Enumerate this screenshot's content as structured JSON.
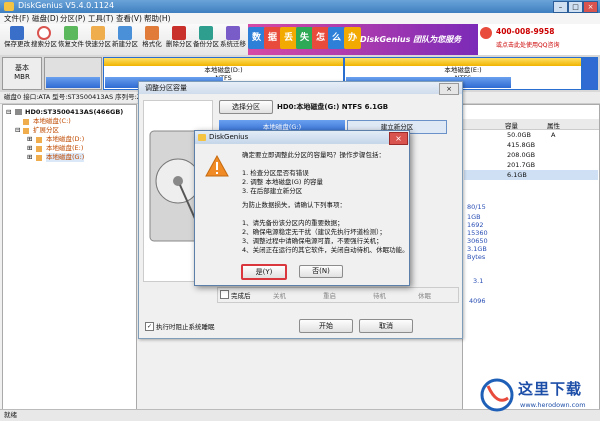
{
  "window": {
    "title": "DiskGenius V5.4.0.1124"
  },
  "menu": [
    "文件(F)",
    "磁盘(D)",
    "分区(P)",
    "工具(T)",
    "查看(V)",
    "帮助(H)"
  ],
  "toolbar": [
    {
      "label": "保存更改",
      "icon": "save-icon",
      "color": "#3a6fc9"
    },
    {
      "label": "搜索分区",
      "icon": "search-icon",
      "color": "#d9534f"
    },
    {
      "label": "恢复文件",
      "icon": "recover-icon",
      "color": "#5cb85c"
    },
    {
      "label": "快速分区",
      "icon": "quick-partition-icon",
      "color": "#f0ad4e"
    },
    {
      "label": "新建分区",
      "icon": "new-partition-icon",
      "color": "#4a90d9"
    },
    {
      "label": "格式化",
      "icon": "format-icon",
      "color": "#e07b39"
    },
    {
      "label": "删除分区",
      "icon": "delete-icon",
      "color": "#c9302c"
    },
    {
      "label": "备份分区",
      "icon": "backup-icon",
      "color": "#2e9e8f"
    },
    {
      "label": "系统迁移",
      "icon": "migrate-icon",
      "color": "#7a5cc9"
    }
  ],
  "banner": {
    "chars": [
      "数",
      "据",
      "丢",
      "失",
      "怎",
      "么",
      "办"
    ],
    "brand": "DiskGenius 团队为您服务",
    "phone": "400-008-9958",
    "qq_note": "或点击此处使用QQ咨询"
  },
  "disk_strip": {
    "left_label": "基本",
    "left_sub": "MBR",
    "partitions": [
      {
        "name": "本地磁盘(D:)",
        "fs": "NTFS"
      },
      {
        "name": "本地磁盘(E:)",
        "fs": "NTFS"
      }
    ]
  },
  "disk_info": "磁盘0 接口:ATA  型号:ST3500413AS  序列号:Z2A...",
  "tree": {
    "disk": "HD0:ST3500413AS(466GB)",
    "items": [
      {
        "label": "本地磁盘(C:)",
        "color": "#c04a00"
      },
      {
        "label": "扩展分区",
        "color": "#c04a00"
      },
      {
        "label": "本地磁盘(D:)",
        "color": "#c04a00"
      },
      {
        "label": "本地磁盘(E:)",
        "color": "#c04a00"
      },
      {
        "label": "本地磁盘(G:)",
        "color": "#c04a00"
      }
    ]
  },
  "right_table": {
    "headers": [
      "容量",
      "属性"
    ],
    "rows": [
      {
        "size": "50.0GB",
        "attr": "A"
      },
      {
        "size": "415.8GB",
        "attr": ""
      },
      {
        "size": "208.0GB",
        "attr": ""
      },
      {
        "size": "201.7GB",
        "attr": ""
      },
      {
        "size": "6.1GB",
        "attr": ""
      }
    ],
    "extra": [
      "80/15",
      "1GB",
      "1692",
      "15360",
      "30650",
      "3.1GB",
      "Bytes",
      "3.1",
      "4096"
    ]
  },
  "resize_dialog": {
    "title": "调整分区容量",
    "select_btn": "选择分区",
    "target": "HD0:本地磁盘(G:) NTFS 6.1GB",
    "left_part": "本地磁盘(G:)",
    "right_part": "建立新分区",
    "complete_label": "完成后",
    "options": [
      "关机",
      "重启",
      "待机",
      "休眠"
    ],
    "prevent_sleep": "执行时阻止系统睡眠",
    "start_btn": "开始",
    "cancel_btn": "取消"
  },
  "confirm": {
    "title": "DiskGenius",
    "lines": [
      "确定要立即调整此分区的容量吗？操作步骤包括：",
      "",
      "1. 检查分区是否有错误",
      "2. 调整 本地磁盘(G) 的容量",
      "3. 在后部建立新分区",
      "",
      "为防止数据损失，请确认下列事项：",
      "",
      "1、请先备份该分区内的重要数据；",
      "2、确保电源稳定无干扰（建议先执行坏道检测）；",
      "3、调整过程中请确保电源可靠，不要强行关机；",
      "4、关闭正在运行的其它软件，关闭自动待机、休眠功能。"
    ],
    "yes_btn": "是(Y)",
    "no_btn": "否(N)"
  },
  "status": "就绪",
  "watermark": {
    "text": "这里下载",
    "url": "www.herodown.com"
  }
}
